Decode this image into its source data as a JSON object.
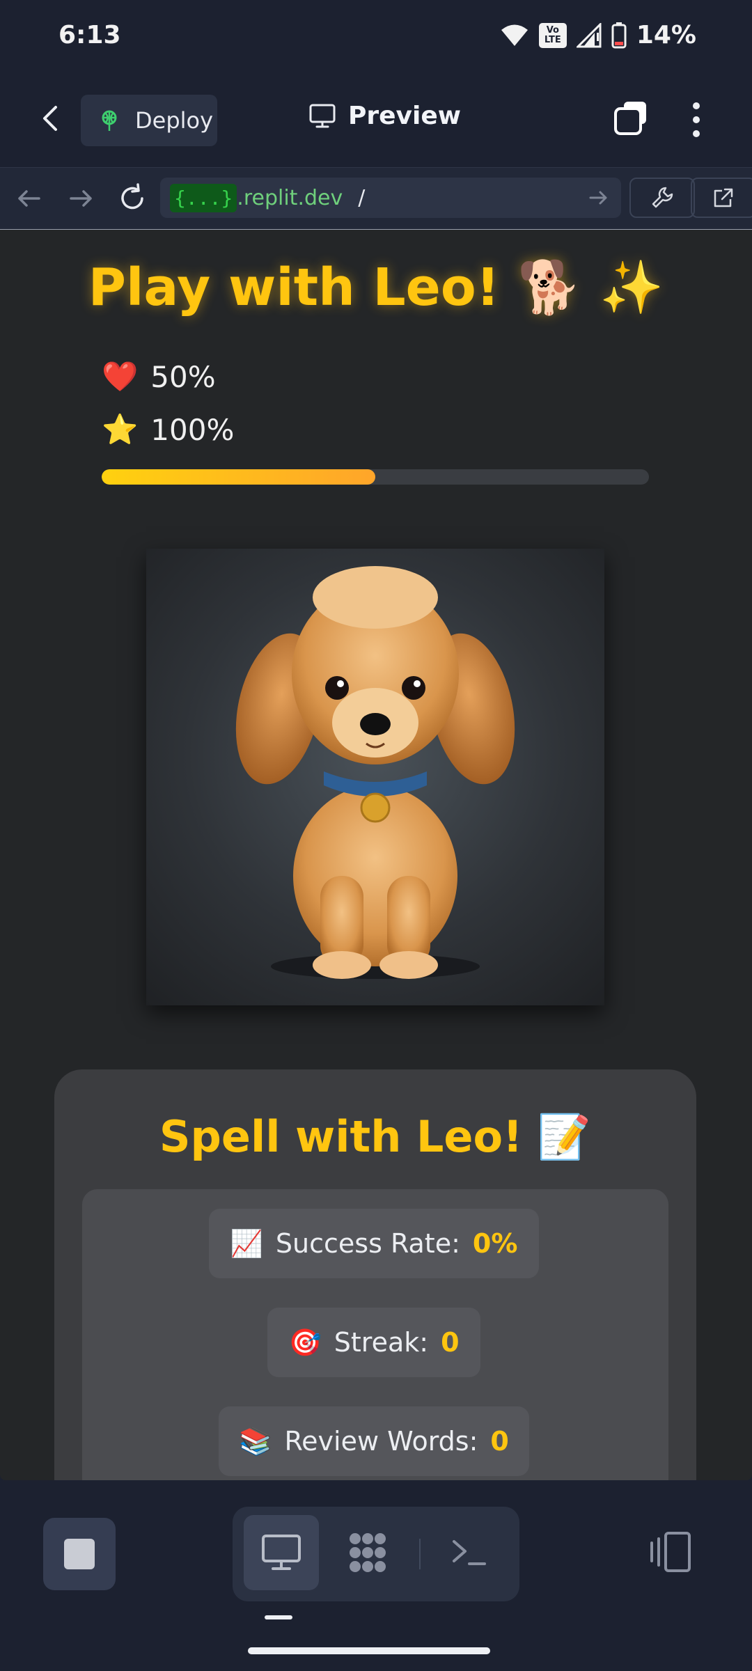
{
  "status_bar": {
    "time": "6:13",
    "battery": "14%",
    "volte_top": "Vo",
    "volte_bottom": "LTE"
  },
  "app_bar": {
    "deploy_label": "Deploy",
    "preview_label": "Preview"
  },
  "browser": {
    "url_badge": "{...}",
    "url_host": ".replit.dev",
    "url_path": "/"
  },
  "game": {
    "title": "Play with Leo! 🐕 ✨",
    "stats": [
      {
        "icon": "❤️",
        "value": "50%"
      },
      {
        "icon": "⭐",
        "value": "100%"
      }
    ],
    "progress_fraction": 0.5
  },
  "spell_card": {
    "title": "Spell with Leo! 📝",
    "stats": [
      {
        "icon": "📈",
        "label": "Success Rate:",
        "value": "0%"
      },
      {
        "icon": "🎯",
        "label": "Streak:",
        "value": "0"
      },
      {
        "icon": "📚",
        "label": "Review Words:",
        "value": "0"
      }
    ]
  },
  "colors": {
    "accent": "#ffc510",
    "progress_start": "#ffd10f",
    "progress_end": "#ffa52a",
    "url_green": "#6fd07c"
  },
  "icons": [
    "back-icon",
    "deploy-icon",
    "monitor-icon",
    "tabs-icon",
    "more-icon",
    "arrow-left-icon",
    "arrow-right-icon",
    "reload-icon",
    "wrench-icon",
    "external-link-icon",
    "stop-icon",
    "workspace-icon",
    "terminal-icon",
    "layout-icon"
  ]
}
